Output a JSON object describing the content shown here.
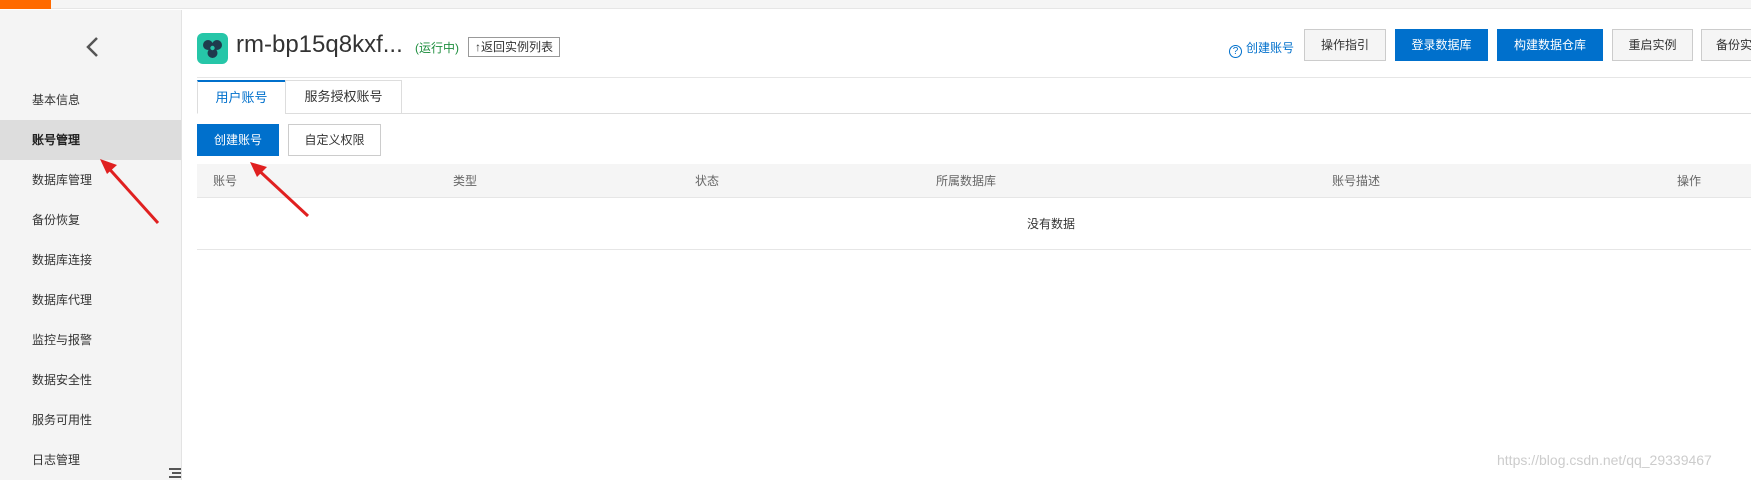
{
  "sidebar": {
    "items": [
      {
        "label": "基本信息"
      },
      {
        "label": "账号管理",
        "active": true
      },
      {
        "label": "数据库管理"
      },
      {
        "label": "备份恢复"
      },
      {
        "label": "数据库连接"
      },
      {
        "label": "数据库代理"
      },
      {
        "label": "监控与报警"
      },
      {
        "label": "数据安全性"
      },
      {
        "label": "服务可用性"
      },
      {
        "label": "日志管理"
      }
    ]
  },
  "header": {
    "instance_name": "rm-bp15q8kxf...",
    "status": "(运行中)",
    "back_to_list": "↑返回实例列表",
    "help_link": "创建账号",
    "buttons": {
      "guide": "操作指引",
      "login_db": "登录数据库",
      "build_warehouse": "构建数据仓库",
      "restart": "重启实例",
      "backup": "备份实"
    }
  },
  "tabs": [
    {
      "label": "用户账号",
      "active": true
    },
    {
      "label": "服务授权账号"
    }
  ],
  "actions": {
    "create_account": "创建账号",
    "custom_permission": "自定义权限"
  },
  "table": {
    "columns": [
      "账号",
      "类型",
      "状态",
      "所属数据库",
      "账号描述",
      "操作"
    ],
    "empty_text": "没有数据"
  },
  "watermark": "https://blog.csdn.net/qq_29339467",
  "colors": {
    "primary": "#0070cc",
    "accent": "#ff6a00",
    "status_green": "#1e8e3e",
    "logo_teal": "#26c6a8",
    "annotation_red": "#e02020"
  }
}
